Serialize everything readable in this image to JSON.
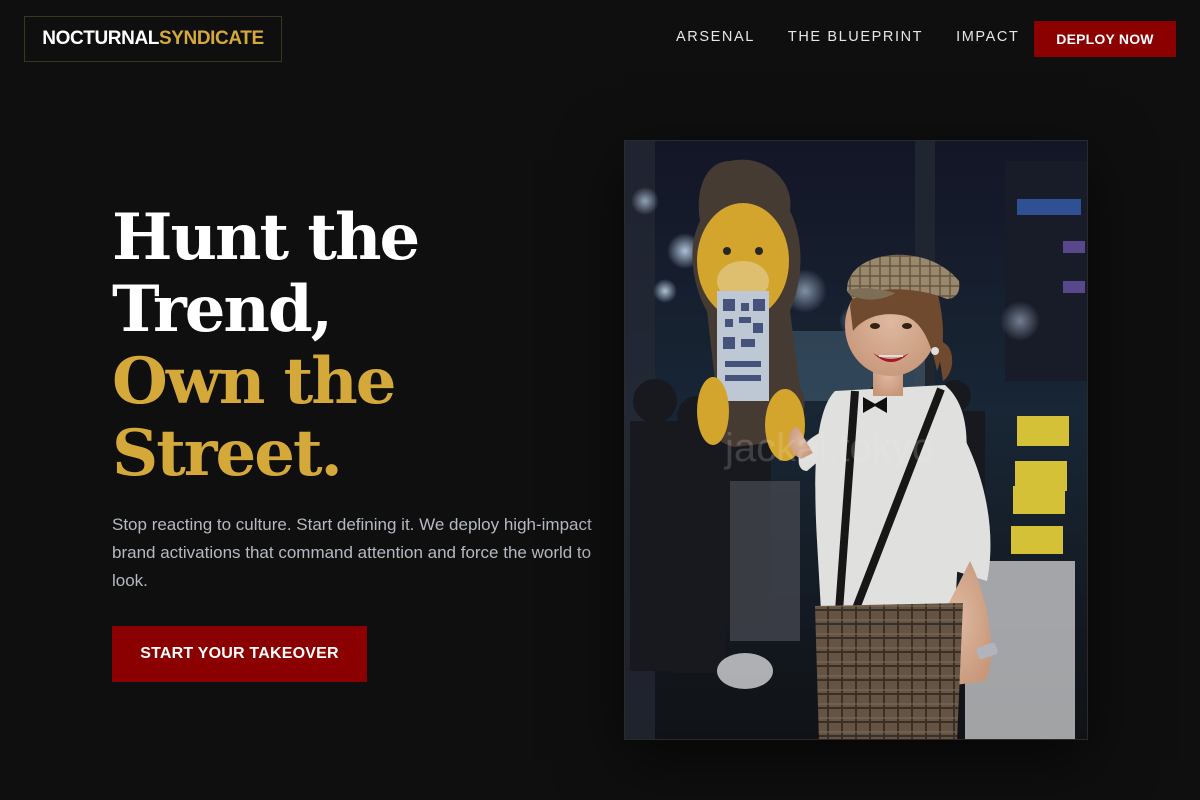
{
  "brand": {
    "part1": "NOCTURNAL",
    "part2": "SYNDICATE"
  },
  "nav": {
    "items": [
      {
        "label": "ARSENAL"
      },
      {
        "label": "THE BLUEPRINT"
      },
      {
        "label": "IMPACT"
      }
    ],
    "cta_label": "DEPLOY NOW"
  },
  "hero": {
    "headline_lines": [
      "Hunt the",
      "Trend,",
      "Own the",
      "Street."
    ],
    "subtext": "Stop reacting to culture. Start defining it. We deploy high-impact brand activations that command attention and force the world to look.",
    "cta_label": "START YOUR TAKEOVER",
    "image_watermark": "jackal.tokyo"
  },
  "colors": {
    "background": "#0f0f0f",
    "accent_gold": "#d4a93a",
    "accent_red": "#8b0000",
    "body_text": "#b5b9c2"
  }
}
